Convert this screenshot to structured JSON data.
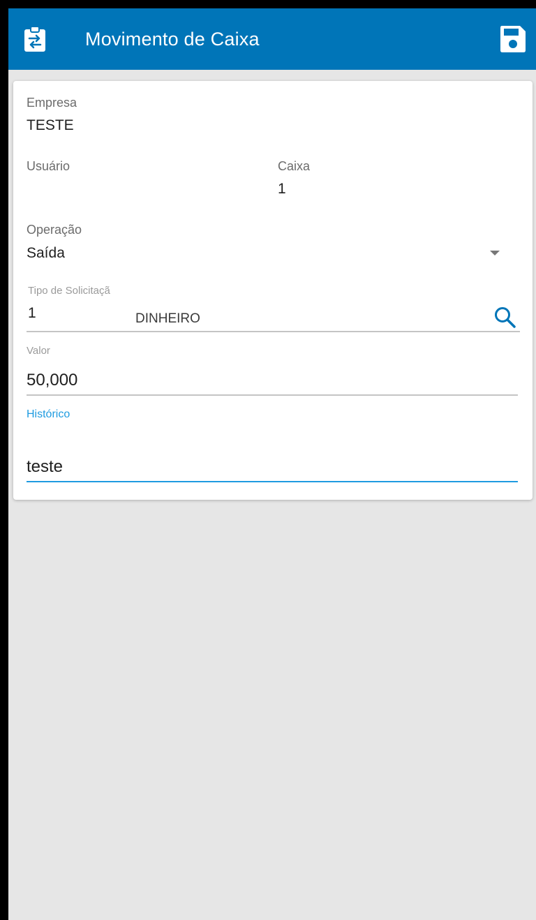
{
  "appbar": {
    "title": "Movimento de Caixa",
    "lead_icon": "clipboard-transfer-icon",
    "save_icon": "save-icon",
    "color": "#0075b8"
  },
  "form": {
    "empresa": {
      "label": "Empresa",
      "value": "TESTE"
    },
    "usuario": {
      "label": "Usuário",
      "value": ""
    },
    "caixa": {
      "label": "Caixa",
      "value": "1"
    },
    "operacao": {
      "label": "Operação",
      "value": "Saída"
    },
    "tipo_solicitacao": {
      "label": "Tipo de Solicitaçã",
      "code": "1",
      "description": "DINHEIRO",
      "search_icon": "search-icon"
    },
    "valor": {
      "label": "Valor",
      "value": "50,000"
    },
    "historico": {
      "label": "Histórico",
      "value": "teste"
    }
  },
  "colors": {
    "accent": "#1e9be0",
    "background": "#e6e6e6"
  }
}
